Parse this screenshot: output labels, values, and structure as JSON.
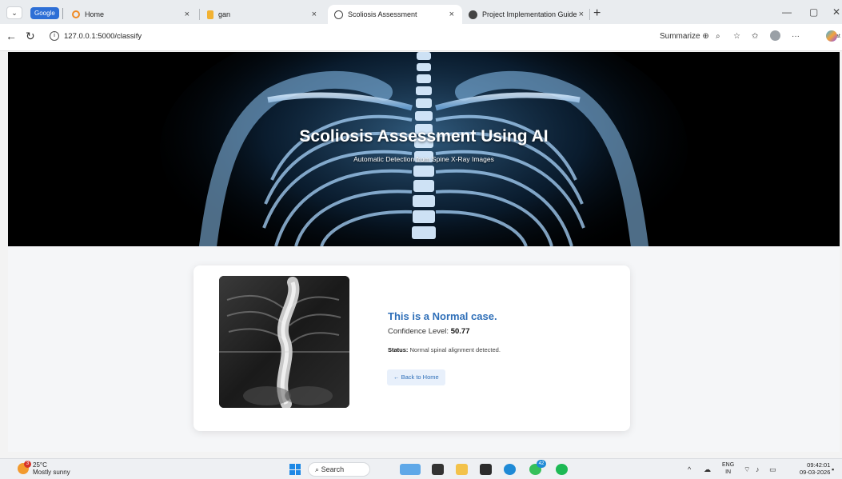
{
  "browser": {
    "tab_group_label": "Google",
    "tabs": [
      {
        "title": "Home",
        "active": false,
        "icon": "loading-ring-icon"
      },
      {
        "title": "gan",
        "active": false,
        "icon": "hourglass-icon"
      },
      {
        "title": "Scoliosis Assessment",
        "active": true,
        "icon": "globe-icon"
      },
      {
        "title": "Project Implementation Guide",
        "active": false,
        "icon": "openai-icon"
      }
    ],
    "url": "127.0.0.1:5000/classify",
    "summarize_label": "Summarize",
    "chat_label": "Chat"
  },
  "hero": {
    "title": "Scoliosis Assessment Using AI",
    "subtitle": "Automatic Detection from Spine X-Ray Images"
  },
  "result": {
    "heading": "This is a Normal case.",
    "confidence_label": "Confidence Level:",
    "confidence_value": "50.77",
    "status_label": "Status:",
    "status_text": "Normal spinal alignment detected.",
    "back_button": "← Back to Home"
  },
  "taskbar": {
    "weather_temp": "25°C",
    "weather_desc": "Mostly sunny",
    "weather_badge": "3",
    "search_label": "Search",
    "whatsapp_badge": "42",
    "lang_top": "ENG",
    "lang_bottom": "IN",
    "time": "09:42:01",
    "date": "09-03-2026"
  },
  "colors": {
    "accent_blue": "#2f6fb8",
    "hero_background": "#000000",
    "card_background": "#ffffff"
  }
}
